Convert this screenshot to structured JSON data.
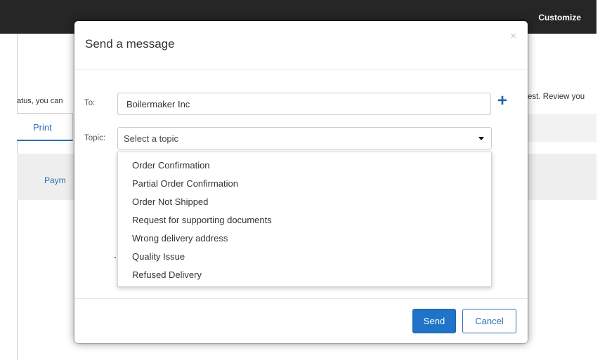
{
  "background": {
    "topbar_link": "Customize",
    "left_text": "atus, you can",
    "right_text": "est. Review you",
    "print_tab": "Print",
    "paym_label": "Paym"
  },
  "modal": {
    "title": "Send a message",
    "close_glyph": "×",
    "to_label": "To:",
    "to_value": "Boilermaker Inc",
    "add_glyph": "+",
    "topic_label": "Topic:",
    "topic_placeholder": "Select a topic",
    "topic_options": [
      "Order Confirmation",
      "Partial Order Confirmation",
      "Order Not Shipped",
      "Request for supporting documents",
      "Wrong delivery address",
      "Quality Issue",
      "Refused Delivery"
    ],
    "send_label": "Send",
    "cancel_label": "Cancel"
  },
  "colors": {
    "accent": "#1f74c8",
    "topbar": "#262626"
  }
}
